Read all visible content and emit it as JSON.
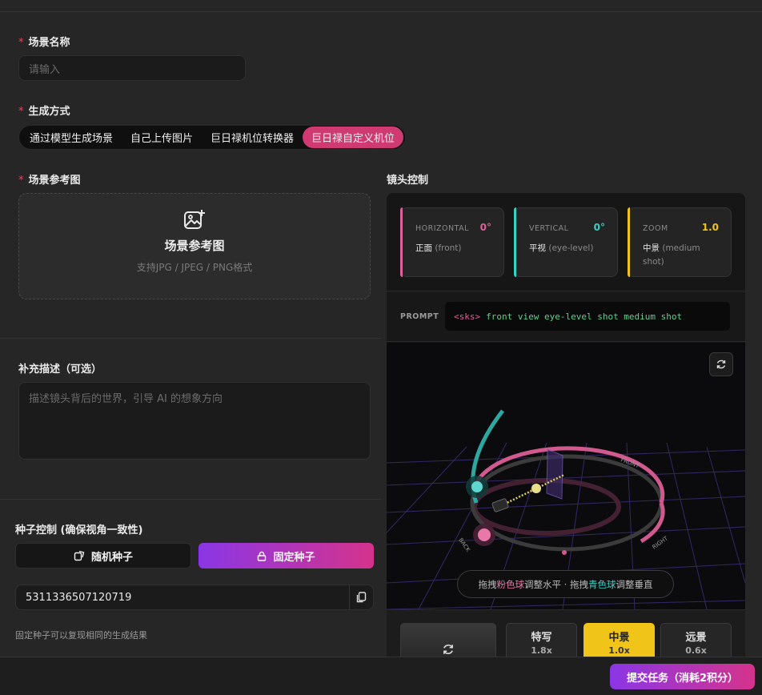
{
  "form": {
    "scene_name_label": "场景名称",
    "scene_name_placeholder": "请输入",
    "method_label": "生成方式",
    "method_tabs": [
      "通过模型生成场景",
      "自己上传图片",
      "巨日禄机位转换器",
      "巨日禄自定义机位"
    ],
    "method_active_index": 3,
    "reference_label": "场景参考图",
    "upload_title": "场景参考图",
    "upload_sub": "支持JPG / JPEG / PNG格式",
    "supplement_label": "补充描述（可选）",
    "supplement_placeholder": "描述镜头背后的世界，引导 AI 的想象方向",
    "seed_label": "种子控制 (确保视角一致性)",
    "random_seed_label": "随机种子",
    "fixed_seed_label": "固定种子",
    "seed_value": "5311336507120719",
    "seed_hint": "固定种子可以复现相同的生成结果"
  },
  "camera": {
    "title": "镜头控制",
    "cards": [
      {
        "title": "HORIZONTAL",
        "value": "0°",
        "desc": "正面",
        "desc_en": "(front)",
        "color": "#e0609a"
      },
      {
        "title": "VERTICAL",
        "value": "0°",
        "desc": "平视",
        "desc_en": "(eye-level)",
        "color": "#3ccfc6"
      },
      {
        "title": "ZOOM",
        "value": "1.0",
        "desc": "中景",
        "desc_en": "(medium shot)",
        "color": "#f0c419"
      }
    ],
    "prompt_label": "PROMPT",
    "prompt_tag": "<sks>",
    "prompt_text": "front view eye-level shot medium shot",
    "viewport_labels": {
      "front": "FRONT",
      "right": "RIGHT",
      "back": "BACK"
    },
    "drag_hint": {
      "p1": "拖拽",
      "pink": "粉色球",
      "p2": "调整水平 · 拖拽",
      "cyan": "青色球",
      "p3": "调整垂直"
    },
    "shots": [
      {
        "name": "特写",
        "mult": "1.8x"
      },
      {
        "name": "中景",
        "mult": "1.0x"
      },
      {
        "name": "远景",
        "mult": "0.6x"
      }
    ],
    "active_shot_index": 1
  },
  "submit_label": "提交任务（消耗2积分）",
  "colors": {
    "pink": "#cf3a72",
    "cyan": "#3ccfc6",
    "yellow": "#f0c419",
    "purple": "#8a36e6"
  }
}
